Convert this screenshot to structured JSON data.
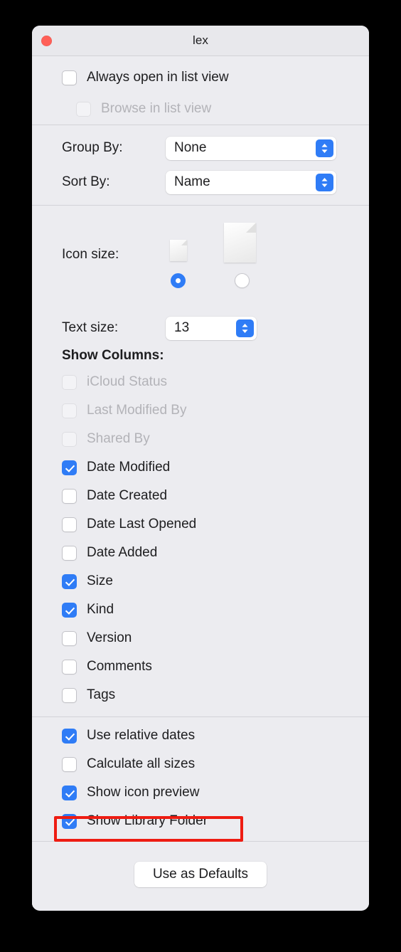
{
  "window": {
    "title": "lex",
    "close_icon": "close-button"
  },
  "view_options": {
    "always_open": {
      "label": "Always open in list view",
      "checked": false,
      "disabled": false
    },
    "browse_list": {
      "label": "Browse in list view",
      "checked": false,
      "disabled": true
    }
  },
  "arrange": {
    "group_by": {
      "label": "Group By:",
      "value": "None"
    },
    "sort_by": {
      "label": "Sort By:",
      "value": "Name"
    }
  },
  "icon_size": {
    "label": "Icon size:",
    "options": [
      {
        "name": "small",
        "selected": true
      },
      {
        "name": "large",
        "selected": false
      }
    ]
  },
  "text_size": {
    "label": "Text size:",
    "value": "13"
  },
  "show_columns": {
    "title": "Show Columns:",
    "items": [
      {
        "label": "iCloud Status",
        "checked": false,
        "disabled": true
      },
      {
        "label": "Last Modified By",
        "checked": false,
        "disabled": true
      },
      {
        "label": "Shared By",
        "checked": false,
        "disabled": true
      },
      {
        "label": "Date Modified",
        "checked": true,
        "disabled": false
      },
      {
        "label": "Date Created",
        "checked": false,
        "disabled": false
      },
      {
        "label": "Date Last Opened",
        "checked": false,
        "disabled": false
      },
      {
        "label": "Date Added",
        "checked": false,
        "disabled": false
      },
      {
        "label": "Size",
        "checked": true,
        "disabled": false
      },
      {
        "label": "Kind",
        "checked": true,
        "disabled": false
      },
      {
        "label": "Version",
        "checked": false,
        "disabled": false
      },
      {
        "label": "Comments",
        "checked": false,
        "disabled": false
      },
      {
        "label": "Tags",
        "checked": false,
        "disabled": false
      }
    ]
  },
  "options": {
    "items": [
      {
        "label": "Use relative dates",
        "checked": true,
        "highlighted": false
      },
      {
        "label": "Calculate all sizes",
        "checked": false,
        "highlighted": false
      },
      {
        "label": "Show icon preview",
        "checked": true,
        "highlighted": false
      },
      {
        "label": "Show Library Folder",
        "checked": true,
        "highlighted": true
      }
    ]
  },
  "footer": {
    "use_as_defaults": "Use as Defaults"
  },
  "colors": {
    "accent": "#2f7cf6",
    "window_bg": "#ececf0",
    "titlebar_bg": "#e8e8ec",
    "close_red": "#ff5f57",
    "annotation_red": "#ee1c12",
    "text": "#1d1d1f",
    "text_disabled": "#b3b3b8"
  }
}
